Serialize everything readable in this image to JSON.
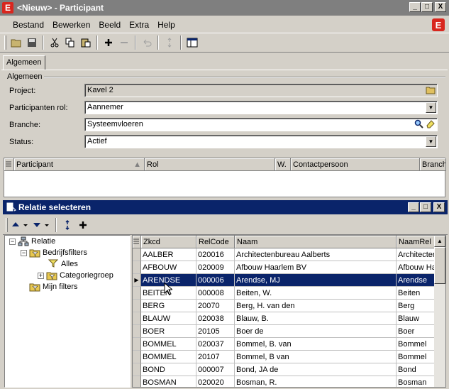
{
  "window": {
    "title": "<Nieuw> - Participant",
    "app_icon": "E",
    "brand_icon": "E",
    "btn_min": "_",
    "btn_max": "□",
    "btn_close": "X"
  },
  "menu": [
    "Bestand",
    "Bewerken",
    "Beeld",
    "Extra",
    "Help"
  ],
  "tab": "Algemeen",
  "group_label": "Algemeen",
  "form": {
    "project": {
      "label": "Project:",
      "value": "Kavel 2"
    },
    "rol": {
      "label": "Participanten rol:",
      "value": "Aannemer"
    },
    "branche": {
      "label": "Branche:",
      "value": "Systeemvloeren"
    },
    "status": {
      "label": "Status:",
      "value": "Actief"
    }
  },
  "grid1": {
    "columns": [
      "Participant",
      "Rol",
      "W.",
      "Contactpersoon",
      "Branche"
    ]
  },
  "dialog": {
    "title": "Relatie selecteren"
  },
  "tree": {
    "root": "Relatie",
    "bedrijfsfilters": "Bedrijfsfilters",
    "alles": "Alles",
    "categoriegroep": "Categoriegroep",
    "mijn_filters": "Mijn filters"
  },
  "grid2": {
    "columns": [
      "Zkcd",
      "RelCode",
      "Naam",
      "NaamRel"
    ],
    "rows": [
      [
        "AALBER",
        "020016",
        "Architectenbureau Aalberts",
        "Architecten"
      ],
      [
        "AFBOUW",
        "020009",
        "Afbouw Haarlem BV",
        "Afbouw Haa"
      ],
      [
        "ARENDSE",
        "000006",
        "Arendse, MJ",
        "Arendse"
      ],
      [
        "BEITEN",
        "000008",
        "Beiten, W.",
        "Beiten"
      ],
      [
        "BERG",
        "20070",
        "Berg, H. van den",
        "Berg"
      ],
      [
        "BLAUW",
        "020038",
        "Blauw, B.",
        "Blauw"
      ],
      [
        "BOER",
        "20105",
        "Boer de",
        "Boer"
      ],
      [
        "BOMMEL",
        "020037",
        "Bommel, B. van",
        "Bommel"
      ],
      [
        "BOMMEL",
        "20107",
        "Bommel, B van",
        "Bommel"
      ],
      [
        "BOND",
        "000007",
        "Bond, JA de",
        "Bond"
      ],
      [
        "BOSMAN",
        "020020",
        "Bosman, R.",
        "Bosman"
      ]
    ],
    "selected_row": 2
  }
}
